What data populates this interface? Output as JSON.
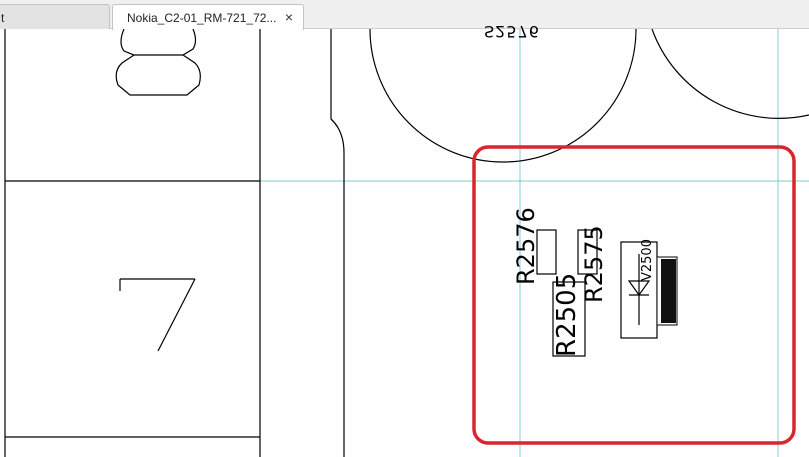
{
  "tabs": [
    {
      "label": "t",
      "active": false
    },
    {
      "label": "Nokia_C2-01_RM-721_72...",
      "active": true,
      "close": "×"
    }
  ],
  "schematic": {
    "digit_7": "7",
    "top_label": "S2576",
    "refs": {
      "r2576": "R2576",
      "r2575": "R2575",
      "r2505": "R2505",
      "v2500": "V2500"
    }
  },
  "colors": {
    "highlight": "#d9262d",
    "guide": "#7ecfd6",
    "line": "#000000"
  }
}
